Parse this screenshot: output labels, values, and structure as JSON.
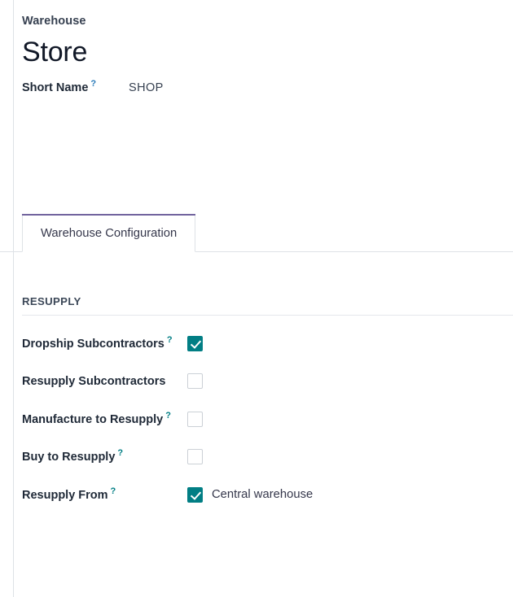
{
  "breadcrumb": "Warehouse",
  "record_title": "Store",
  "short_name": {
    "label": "Short Name",
    "help": "?",
    "value": "SHOP"
  },
  "notebook": {
    "tabs": [
      {
        "label": "Warehouse Configuration",
        "active": true
      }
    ]
  },
  "group": {
    "title": "RESUPPLY",
    "rows": [
      {
        "label": "Dropship Subcontractors",
        "help": "?",
        "checked": true,
        "value_text": ""
      },
      {
        "label": "Resupply Subcontractors",
        "help": "",
        "checked": false,
        "value_text": ""
      },
      {
        "label": "Manufacture to Resupply",
        "help": "?",
        "checked": false,
        "value_text": ""
      },
      {
        "label": "Buy to Resupply",
        "help": "?",
        "checked": false,
        "value_text": ""
      },
      {
        "label": "Resupply From",
        "help": "?",
        "checked": true,
        "value_text": "Central warehouse"
      }
    ]
  },
  "colors": {
    "accent_teal": "#017e84",
    "tab_top_accent": "#71639e",
    "help_blue": "#2b7bb9",
    "border": "#dee2e6",
    "title": "#111827"
  }
}
